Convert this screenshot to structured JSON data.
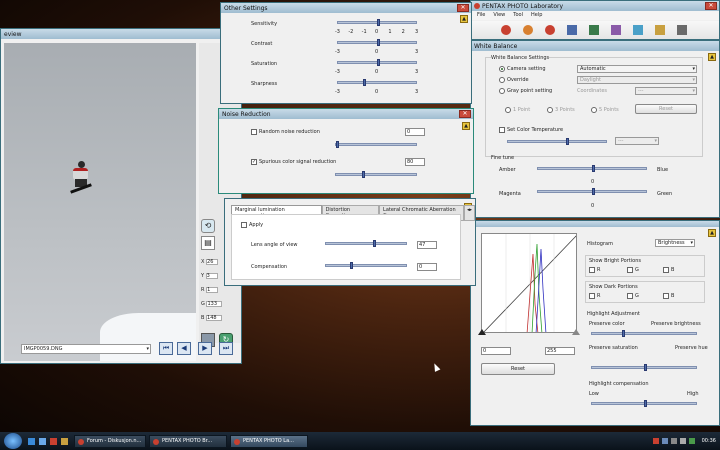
{
  "taskbar": {
    "items": [
      {
        "label": "Forum - Diskusjon.n..."
      },
      {
        "label": "PENTAX PHOTO Br..."
      },
      {
        "label": "PENTAX PHOTO La..."
      }
    ],
    "clock": "00:36"
  },
  "preview_window": {
    "title": "eview",
    "file_select": "IMGP0059.DNG",
    "readout": [
      {
        "label": "X",
        "value": "26"
      },
      {
        "label": "Y",
        "value": "3"
      },
      {
        "label": "R",
        "value": "1"
      },
      {
        "label": "G",
        "value": "133"
      },
      {
        "label": "B",
        "value": "148"
      }
    ]
  },
  "lab_window": {
    "title": "PENTAX PHOTO Laboratory",
    "menu": [
      "File",
      "View",
      "Tool",
      "Help"
    ]
  },
  "other_settings": {
    "title": "Other Settings",
    "rows": [
      {
        "label": "Sensitivity",
        "ticks": [
          "-3",
          "-2",
          "-1",
          "0",
          "1",
          "2",
          "3"
        ],
        "pos": 0.5
      },
      {
        "label": "Contrast",
        "ticks": [
          "-3",
          "0",
          "3"
        ],
        "pos": 0.5
      },
      {
        "label": "Saturation",
        "ticks": [
          "-3",
          "0",
          "3"
        ],
        "pos": 0.5
      },
      {
        "label": "Sharpness",
        "ticks": [
          "-3",
          "0",
          "3"
        ],
        "pos": 0.33
      }
    ]
  },
  "noise_reduction": {
    "title": "Noise Reduction",
    "random_label": "Random noise reduction",
    "random_value": "0",
    "random_pos": 0,
    "spurious_label": "Spurious color signal reduction",
    "spurious_value": "80",
    "spurious_pos": 0.33
  },
  "lens_correction": {
    "tabs": [
      "Marginal lumination compensation",
      "Distortion Correction",
      "Lateral Chromatic Aberration Co"
    ],
    "apply_label": "Apply",
    "lens_angle_label": "Lens angle of view",
    "lens_angle_value": "47",
    "lens_angle_pos": 0.6,
    "compensation_label": "Compensation",
    "compensation_value": "0",
    "compensation_pos": 0.3
  },
  "white_balance": {
    "title": "White Balance",
    "settings_label": "White Balance Settings",
    "camera_setting": "Camera setting",
    "camera_value": "Automatic",
    "override": "Override",
    "override_value": "Daylight",
    "gray_point": "Gray point setting",
    "coordinates": "Coordinates",
    "coord_value": "---",
    "points": [
      "1 Point",
      "3 Points",
      "5 Points"
    ],
    "reset": "Reset",
    "color_temp_label": "Set Color Temperature",
    "color_temp_value": "---",
    "fine_tune": "Fine tune",
    "amber": "Amber",
    "blue": "Blue",
    "magenta": "Magenta",
    "green": "Green",
    "ab_value": "0",
    "mg_value": "0"
  },
  "histogram_panel": {
    "histogram_label": "Histogram",
    "mode": "Brightness",
    "bright_label": "Show Bright Portions",
    "dark_label": "Show Dark Portions",
    "channels": [
      "R",
      "G",
      "B"
    ],
    "low_value": "0",
    "high_value": "255",
    "reset": "Reset",
    "highlight_adj": "Highlight Adjustment",
    "preserve_color": "Preserve color",
    "preserve_brightness": "Preserve brightness",
    "preserve_saturation": "Preserve saturation",
    "preserve_hue": "Preserve hue",
    "highlight_comp": "Highlight compensation",
    "low": "Low",
    "high": "High"
  },
  "colors": {
    "title_bar": "#9fbcd0",
    "slider_thumb": "#4a6aa8",
    "close_button": "#c94a3a"
  }
}
